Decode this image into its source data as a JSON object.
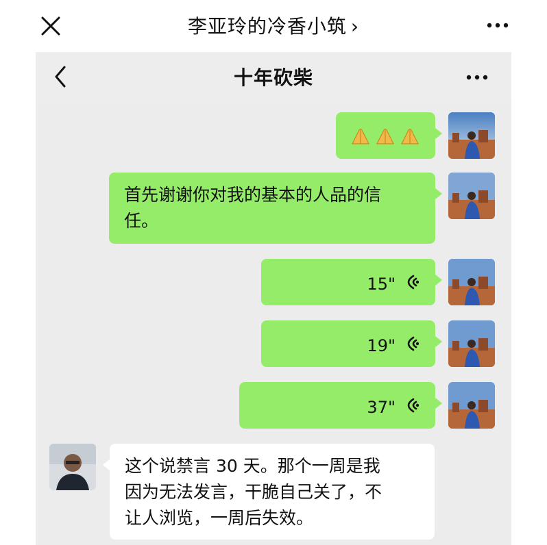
{
  "outer": {
    "title": "李亚玲的冷香小筑",
    "close_icon": "close-icon",
    "more_icon": "more-dots-icon"
  },
  "chat": {
    "title": "十年砍柴",
    "back_icon": "back-chevron-icon",
    "more_icon": "more-dots-icon"
  },
  "messages": [
    {
      "side": "right",
      "type": "emoji",
      "emoji_icon": "praying-hands-emoji",
      "emoji_count": 3
    },
    {
      "side": "right",
      "type": "text",
      "lines": [
        "首先谢谢你对我的基本的人品的信",
        "任。"
      ]
    },
    {
      "side": "right",
      "type": "voice",
      "duration": "15\""
    },
    {
      "side": "right",
      "type": "voice",
      "duration": "19\""
    },
    {
      "side": "right",
      "type": "voice",
      "duration": "37\""
    },
    {
      "side": "left",
      "type": "text",
      "lines": [
        "这个说禁言 30 天。那个一周是我",
        "因为无法发言，干脆自己关了，不",
        "让人浏览，一周后失效。"
      ]
    }
  ],
  "colors": {
    "sent_bubble": "#95ec69",
    "received_bubble": "#ffffff",
    "chat_background": "#ececec"
  }
}
